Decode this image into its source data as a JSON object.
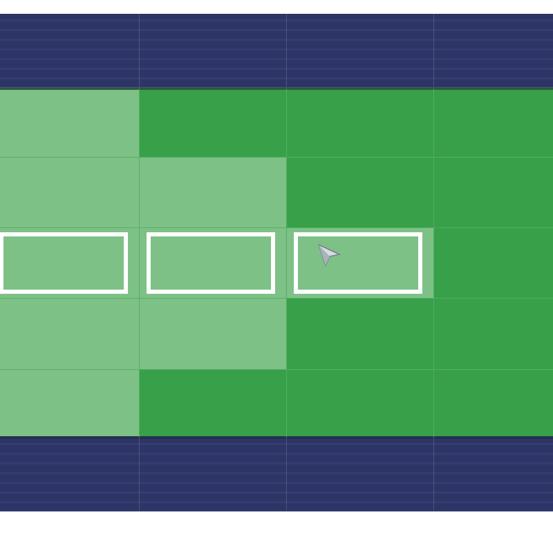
{
  "map": {
    "rows": [
      [
        {
          "terrain": "water",
          "highlighted": false,
          "selected": false,
          "hovered": false
        },
        {
          "terrain": "water",
          "highlighted": false,
          "selected": false,
          "hovered": false
        },
        {
          "terrain": "water",
          "highlighted": false,
          "selected": false,
          "hovered": false
        },
        {
          "terrain": "water",
          "highlighted": false,
          "selected": false,
          "hovered": false
        }
      ],
      [
        {
          "terrain": "grass",
          "highlighted": true,
          "selected": false,
          "hovered": false
        },
        {
          "terrain": "grass",
          "highlighted": false,
          "selected": false,
          "hovered": false
        },
        {
          "terrain": "grass",
          "highlighted": false,
          "selected": false,
          "hovered": false
        },
        {
          "terrain": "grass",
          "highlighted": false,
          "selected": false,
          "hovered": false
        }
      ],
      [
        {
          "terrain": "grass",
          "highlighted": true,
          "selected": false,
          "hovered": false
        },
        {
          "terrain": "grass",
          "highlighted": true,
          "selected": false,
          "hovered": false
        },
        {
          "terrain": "grass",
          "highlighted": false,
          "selected": false,
          "hovered": false
        },
        {
          "terrain": "grass",
          "highlighted": false,
          "selected": false,
          "hovered": false
        }
      ],
      [
        {
          "terrain": "grass",
          "highlighted": true,
          "selected": true,
          "hovered": false
        },
        {
          "terrain": "grass",
          "highlighted": true,
          "selected": true,
          "hovered": false
        },
        {
          "terrain": "grass",
          "highlighted": true,
          "selected": true,
          "hovered": true
        },
        {
          "terrain": "grass",
          "highlighted": false,
          "selected": false,
          "hovered": false
        }
      ],
      [
        {
          "terrain": "grass",
          "highlighted": true,
          "selected": false,
          "hovered": false
        },
        {
          "terrain": "grass",
          "highlighted": true,
          "selected": false,
          "hovered": false
        },
        {
          "terrain": "grass",
          "highlighted": false,
          "selected": false,
          "hovered": false
        },
        {
          "terrain": "grass",
          "highlighted": false,
          "selected": false,
          "hovered": false
        }
      ],
      [
        {
          "terrain": "grass",
          "highlighted": true,
          "selected": false,
          "hovered": false
        },
        {
          "terrain": "grass",
          "highlighted": false,
          "selected": false,
          "hovered": false
        },
        {
          "terrain": "grass",
          "highlighted": false,
          "selected": false,
          "hovered": false
        },
        {
          "terrain": "grass",
          "highlighted": false,
          "selected": false,
          "hovered": false
        }
      ],
      [
        {
          "terrain": "water",
          "highlighted": false,
          "selected": false,
          "hovered": false
        },
        {
          "terrain": "water",
          "highlighted": false,
          "selected": false,
          "hovered": false
        },
        {
          "terrain": "water",
          "highlighted": false,
          "selected": false,
          "hovered": false
        },
        {
          "terrain": "water",
          "highlighted": false,
          "selected": false,
          "hovered": false
        }
      ]
    ]
  }
}
